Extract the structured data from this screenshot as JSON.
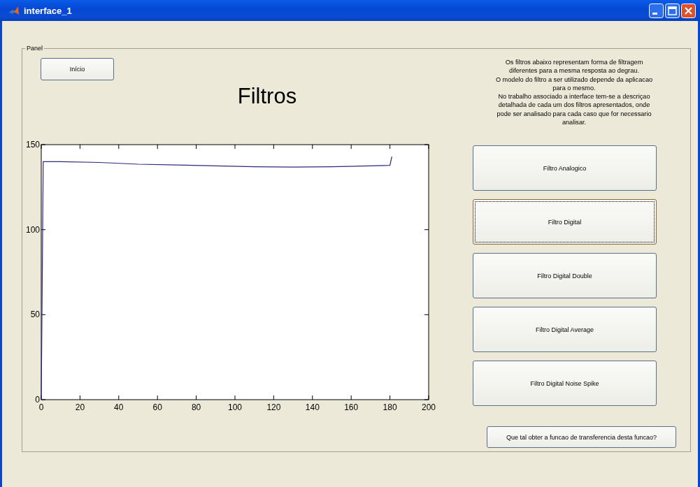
{
  "window": {
    "title": "interface_1"
  },
  "panel": {
    "title": "Panel"
  },
  "start_button": {
    "label": "Início"
  },
  "heading": "Filtros",
  "description": [
    "Os filtros abaixo representam forma de filtragem",
    "diferentes para a mesma resposta ao degrau.",
    "O modelo do filtro a ser utilizado depende da aplicacao",
    "para o mesmo.",
    "No trabalho associado a interface tem-se a descriçao",
    "detalhada de cada um dos filtros apresentados, onde",
    "pode ser analisado para cada caso que for necessario",
    "analisar."
  ],
  "chart": {
    "chart_data": {
      "type": "line",
      "x": [
        0,
        1,
        10,
        30,
        50,
        70,
        90,
        110,
        130,
        150,
        170,
        180,
        181
      ],
      "series": [
        {
          "color": "#2b2b7a",
          "values": [
            0,
            140,
            140,
            139.5,
            138.5,
            138,
            137.5,
            137,
            136.8,
            137,
            137.5,
            137.8,
            143
          ]
        }
      ],
      "xlim": [
        0,
        200
      ],
      "ylim": [
        0,
        150
      ],
      "xticks": [
        0,
        20,
        40,
        60,
        80,
        100,
        120,
        140,
        160,
        180,
        200
      ],
      "yticks": [
        0,
        50,
        100,
        150
      ]
    }
  },
  "filter_buttons": [
    {
      "label": "Filtro Analogico",
      "selected": false
    },
    {
      "label": "Filtro Digital",
      "selected": true
    },
    {
      "label": "Filtro Digital Double",
      "selected": false
    },
    {
      "label": "Filtro Digital Average",
      "selected": false
    },
    {
      "label": "Filtro Digital Noise Spike",
      "selected": false
    }
  ],
  "transfer_button": {
    "label": "Que tal obter a funcao de transferencia desta funcao?"
  }
}
